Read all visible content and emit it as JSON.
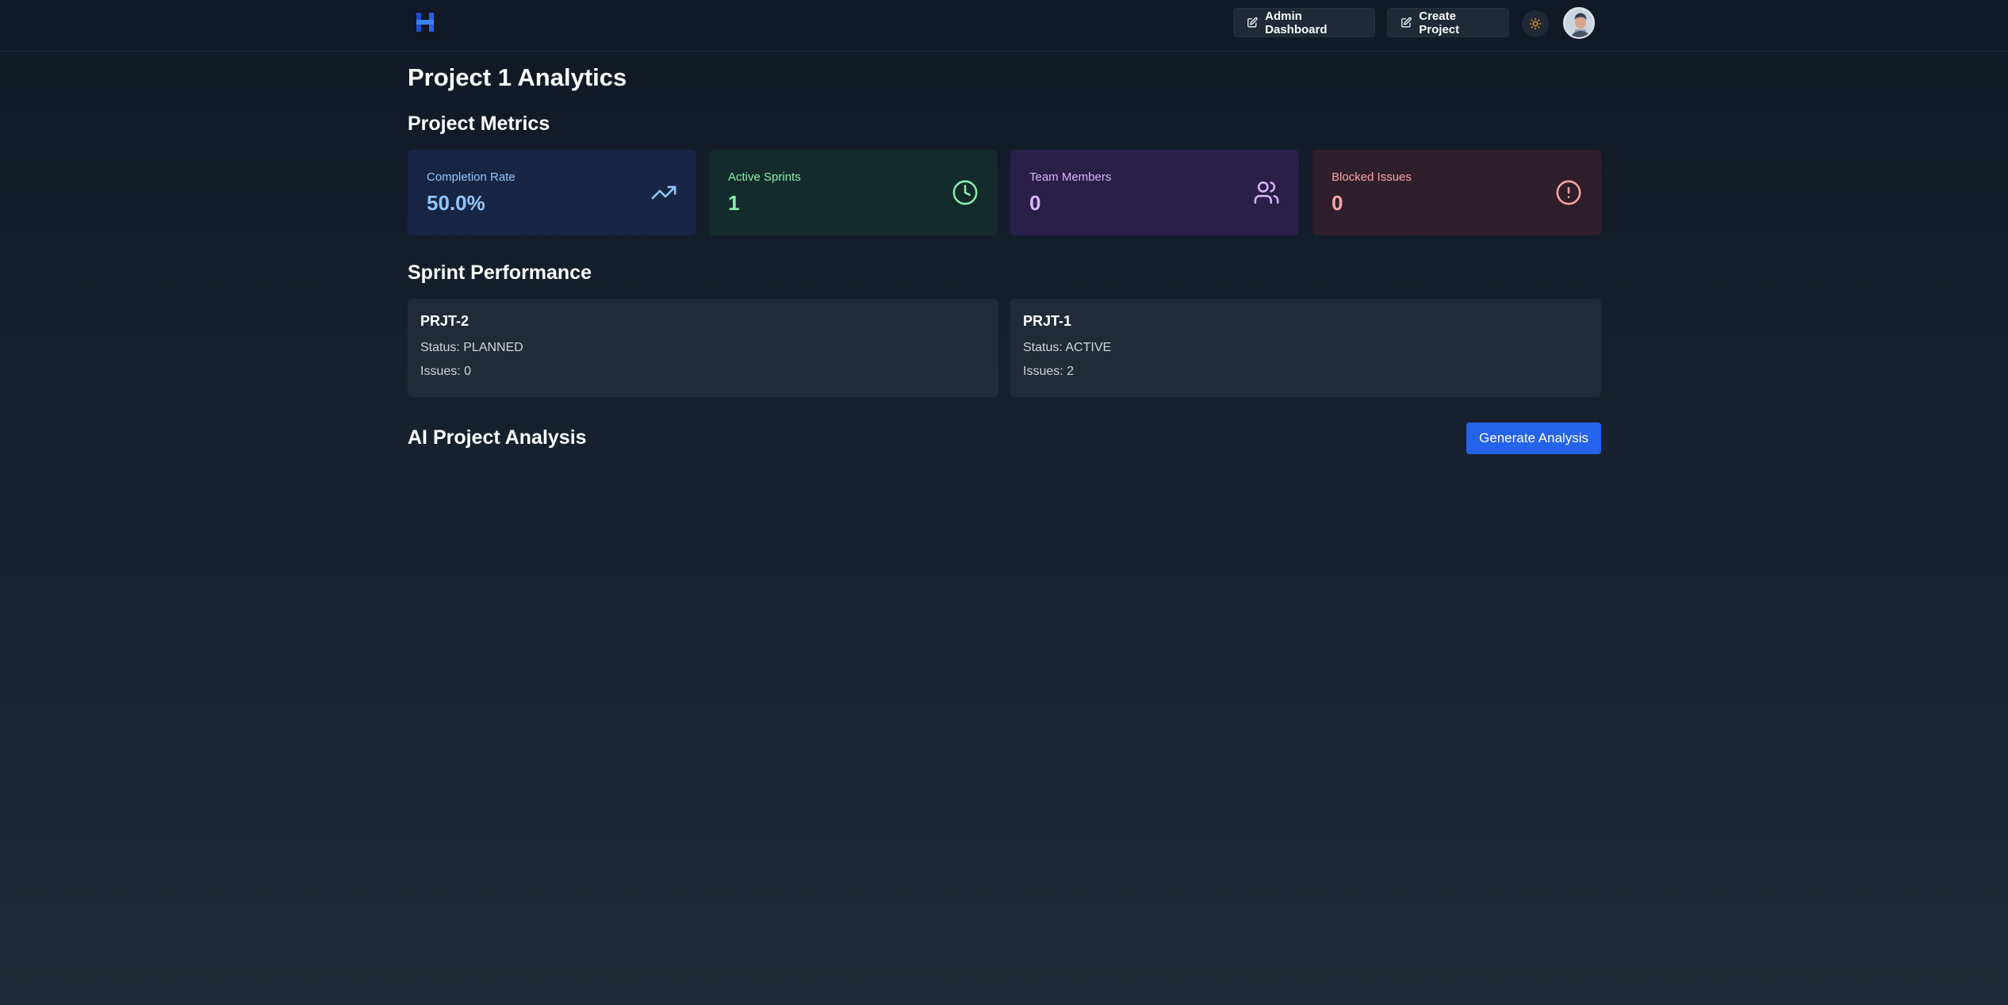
{
  "header": {
    "admin_dashboard_label": "Admin Dashboard",
    "create_project_label": "Create Project"
  },
  "page": {
    "title": "Project 1 Analytics"
  },
  "metrics": {
    "section_title": "Project Metrics",
    "cards": [
      {
        "label": "Completion Rate",
        "value": "50.0%",
        "icon": "trending-up-icon",
        "color": "#93c5fd"
      },
      {
        "label": "Active Sprints",
        "value": "1",
        "icon": "clock-icon",
        "color": "#86efac"
      },
      {
        "label": "Team Members",
        "value": "0",
        "icon": "users-icon",
        "color": "#d8b4fe"
      },
      {
        "label": "Blocked Issues",
        "value": "0",
        "icon": "alert-circle-icon",
        "color": "#fca5a5"
      }
    ]
  },
  "sprints": {
    "section_title": "Sprint Performance",
    "items": [
      {
        "name": "PRJT-2",
        "status": "Status: PLANNED",
        "issues": "Issues: 0"
      },
      {
        "name": "PRJT-1",
        "status": "Status: ACTIVE",
        "issues": "Issues: 2"
      }
    ]
  },
  "ai_analysis": {
    "section_title": "AI Project Analysis",
    "generate_label": "Generate Analysis"
  },
  "colors": {
    "accent": "#2563eb",
    "logo": "#2563eb",
    "sun": "#f59e0b"
  }
}
